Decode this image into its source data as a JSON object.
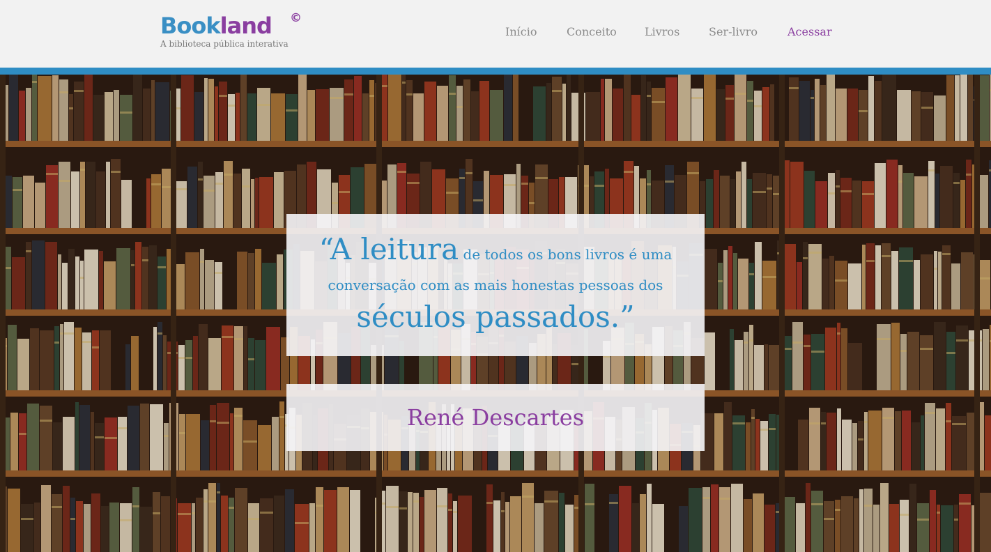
{
  "brand": {
    "name_part1": "Book",
    "name_part2": "land",
    "copyright": "©",
    "tagline": "A biblioteca pública  interativa"
  },
  "nav": {
    "items": [
      "Início",
      "Conceito",
      "Livros",
      "Ser-livro",
      "Acessar"
    ],
    "active": "Acessar"
  },
  "quote": {
    "open_mark": "“",
    "lead": "A leitura",
    "line1_rest": " de todos os bons livros é uma",
    "line2": "conversação com as mais honestas pessoas dos",
    "line3": "séculos passados.",
    "close_mark": "”"
  },
  "author": "René Descartes",
  "colors": {
    "blue": "#2f8dc4",
    "purple": "#8a3ea0",
    "nav_gray": "#8b8b8b",
    "header_bg": "#f2f2f2"
  },
  "icons": {
    "background": "bookshelf-photo"
  }
}
